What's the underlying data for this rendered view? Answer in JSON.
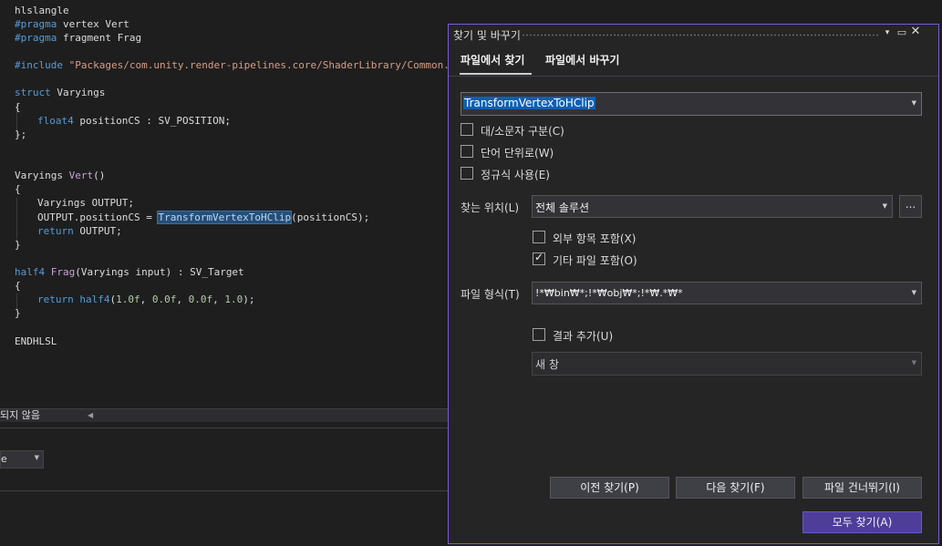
{
  "editor": {
    "lines": {
      "l1": "hlslangle",
      "l2_kw": "#pragma",
      "l2_rest": " vertex Vert",
      "l3_kw": "#pragma",
      "l3_rest": " fragment Frag",
      "l5_kw": "#include",
      "l5_str": " \"Packages/com.unity.render-pipelines.core/ShaderLibrary/Common.hls",
      "l7_kw": "struct",
      "l7_rest": " Varyings",
      "l8": "{",
      "l9_kw": "float4",
      "l9_rest": " positionCS : SV_POSITION;",
      "l10": "};",
      "l13_type": "Varyings",
      "l13_fn": "Vert",
      "l13_rest": "()",
      "l14": "{",
      "l15": "Varyings OUTPUT;",
      "l16_a": "OUTPUT.positionCS = ",
      "l16_hl": "TransformVertexToHClip",
      "l16_b": "(positionCS);",
      "l17_kw": "return",
      "l17_rest": " OUTPUT;",
      "l18": "}",
      "l20_kw": "half4",
      "l20_fn": "Frag",
      "l20_rest": "(Varyings input) : SV_Target",
      "l21": "{",
      "l22_kw": "return",
      "l22_kw2": "half4",
      "l22_p1": "(",
      "l22_n1": "1.0f",
      "l22_c1": ", ",
      "l22_n2": "0.0f",
      "l22_c2": ", ",
      "l22_n3": "0.0f",
      "l22_c3": ", ",
      "l22_n4": "1.0",
      "l22_p2": ");",
      "l23": "}",
      "l25": "ENDHLSL"
    }
  },
  "lower_panel": {
    "scroll_label": "되지 않음",
    "combo_value": "e"
  },
  "find_window": {
    "title": "찾기 및 바꾸기",
    "tabs": [
      "파일에서 찾기",
      "파일에서 바꾸기"
    ],
    "find_value": "TransformVertexToHClip",
    "options": {
      "match_case": {
        "label": "대/소문자 구분(C)",
        "checked": false
      },
      "whole_word": {
        "label": "단어 단위로(W)",
        "checked": false
      },
      "regex": {
        "label": "정규식 사용(E)",
        "checked": false
      }
    },
    "look_in_label": "찾는 위치(L)",
    "look_in_value": "전체 솔루션",
    "browse_label": "...",
    "include_external": {
      "label": "외부 항목 포함(X)",
      "checked": false
    },
    "include_misc": {
      "label": "기타 파일 포함(O)",
      "checked": true
    },
    "file_types_label": "파일 형식(T)",
    "file_types_value": "!*₩bin₩*;!*₩obj₩*;!*₩.*₩*",
    "append_results": {
      "label": "결과 추가(U)",
      "checked": false
    },
    "results_window": "새 창",
    "buttons": {
      "prev": "이전 찾기(P)",
      "next": "다음 찾기(F)",
      "skip": "파일 건너뛰기(I)",
      "find_all": "모두 찾기(A)"
    },
    "check_glyph": "✓"
  },
  "colors": {
    "accent_border": "#7a5cd0",
    "primary_button": "#4e3e9a",
    "selection": "#0e5fb6"
  }
}
